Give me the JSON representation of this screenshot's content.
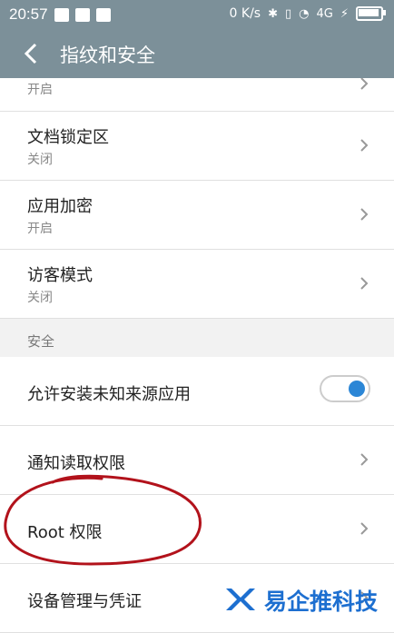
{
  "status": {
    "time": "20:57",
    "network": "0 K/s",
    "signal_tag": "4G"
  },
  "header": {
    "title": "指纹和安全"
  },
  "items": [
    {
      "title": "",
      "subtitle": "开启"
    },
    {
      "title": "文档锁定区",
      "subtitle": "关闭"
    },
    {
      "title": "应用加密",
      "subtitle": "开启"
    },
    {
      "title": "访客模式",
      "subtitle": "关闭"
    }
  ],
  "section": {
    "label": "安全"
  },
  "security_items": [
    {
      "title": "允许安装未知来源应用",
      "toggle_on": true
    },
    {
      "title": "通知读取权限"
    },
    {
      "title": "Root 权限"
    },
    {
      "title": "设备管理与凭证"
    }
  ],
  "watermark": {
    "text": "易企推科技"
  },
  "colors": {
    "header": "#7c9099",
    "toggle": "#2b86d6",
    "annotation": "#b2121b"
  }
}
